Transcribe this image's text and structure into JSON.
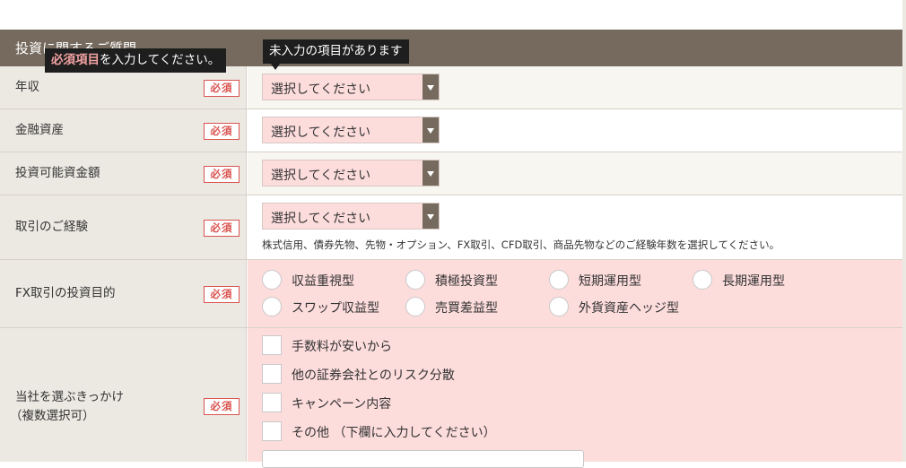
{
  "section": {
    "title": "投資に関するご質問"
  },
  "required_badge": "必須",
  "rows": {
    "income": {
      "label": "年収",
      "select_value": "選択してください"
    },
    "assets": {
      "label": "金融資産",
      "select_value": "選択してください"
    },
    "investable": {
      "label": "投資可能資金額",
      "select_value": "選択してください"
    },
    "experience": {
      "label": "取引のご経験",
      "select_value": "選択してください",
      "note": "株式信用、債券先物、先物・オプション、FX取引、CFD取引、商品先物などのご経験年数を選択してください。"
    },
    "fx_purpose": {
      "label": "FX取引の投資目的",
      "options": [
        "収益重視型",
        "積極投資型",
        "短期運用型",
        "長期運用型",
        "スワップ収益型",
        "売買差益型",
        "外貨資産ヘッジ型"
      ]
    },
    "reason": {
      "label_line1": "当社を選ぶきっかけ",
      "label_line2": "（複数選択可）",
      "options": [
        "手数料が安いから",
        "他の証券会社とのリスク分散",
        "キャンペーン内容",
        "その他 （下欄に入力してください）"
      ]
    }
  },
  "tooltips": {
    "required_emphasis": "必須項目",
    "required_rest": "を入力してください。",
    "unfilled": "未入力の項目があります"
  },
  "colors": {
    "header_bg": "#756a5d",
    "label_bg": "#ece9e3",
    "required_red": "#d9534f",
    "error_pink": "#fddcdc",
    "tooltip_bg": "#1e1e1e"
  }
}
